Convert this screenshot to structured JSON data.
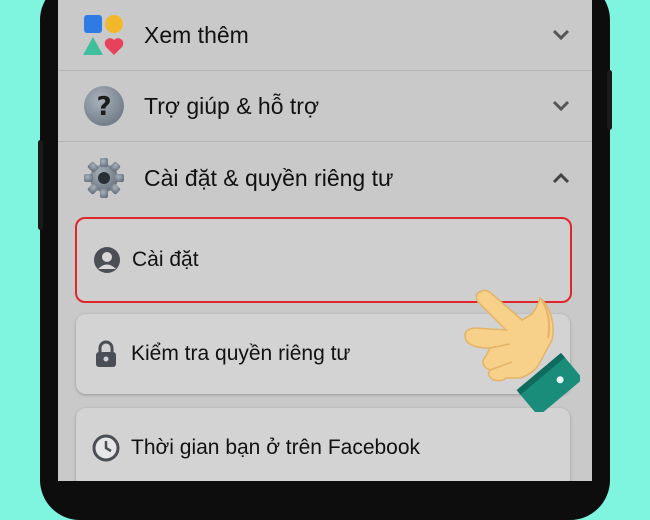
{
  "menu": {
    "items": [
      {
        "label": "Xem thêm",
        "icon": "shapes-icon",
        "chevron": "down"
      },
      {
        "label": "Trợ giúp & hỗ trợ",
        "icon": "question-icon",
        "chevron": "down"
      },
      {
        "label": "Cài đặt & quyền riêng tư",
        "icon": "gear-icon",
        "chevron": "up"
      }
    ],
    "submenu": [
      {
        "label": "Cài đặt",
        "icon": "profile-icon",
        "selected": true
      },
      {
        "label": "Kiểm tra quyền riêng tư",
        "icon": "lock-icon",
        "selected": false
      },
      {
        "label": "Thời gian bạn ở trên Facebook",
        "icon": "clock-icon",
        "selected": false
      }
    ]
  },
  "colors": {
    "background": "#7ff5e0",
    "screen": "#c9c9c9",
    "highlight_border": "#e0252b",
    "hand_skin": "#f7d08a",
    "hand_cuff": "#1a8c7a"
  }
}
